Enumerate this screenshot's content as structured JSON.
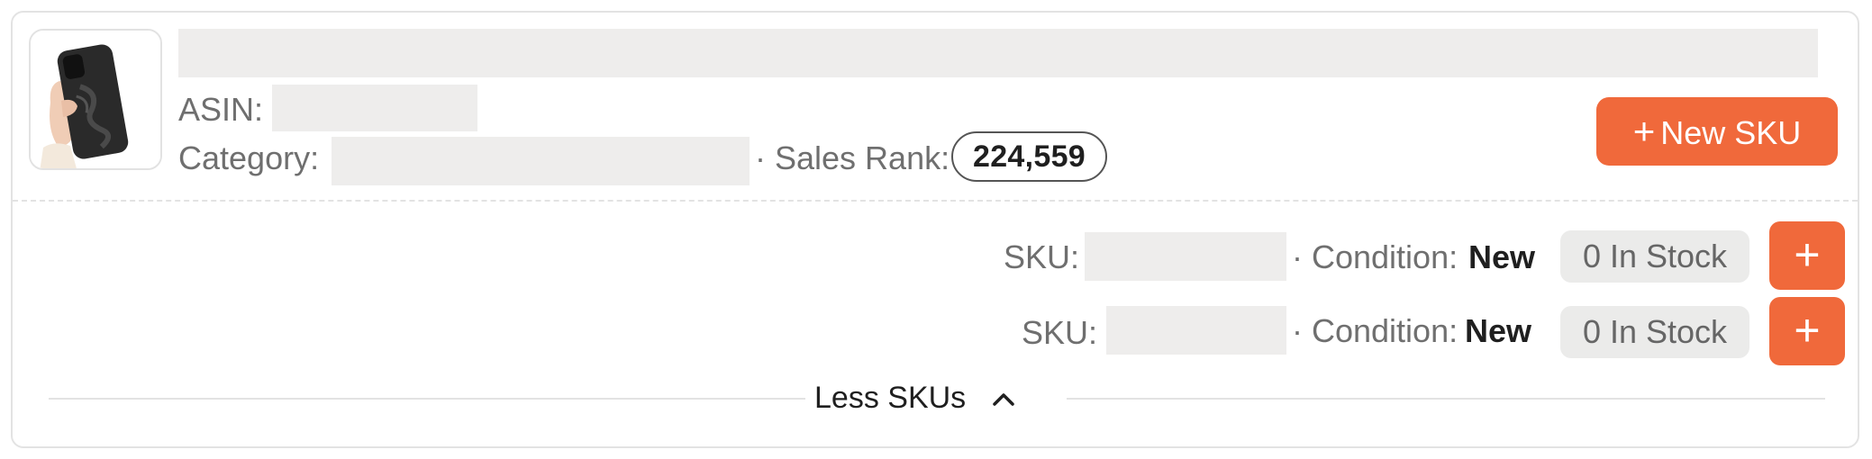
{
  "product": {
    "asin_label": "ASIN:",
    "category_label": "Category:",
    "sales_rank_label": "· Sales Rank:",
    "sales_rank_value": "224,559",
    "new_sku_label": "New SKU",
    "thumbnail_icon": "phone-case-thumbnail"
  },
  "skus": [
    {
      "sku_label": "SKU:",
      "condition_label": "· Condition:",
      "condition_value": "New",
      "stock_text": "0 In Stock",
      "add_icon": "plus-icon"
    },
    {
      "sku_label": "SKU:",
      "condition_label": "· Condition:",
      "condition_value": "New",
      "stock_text": "0 In Stock",
      "add_icon": "plus-icon"
    }
  ],
  "toggle": {
    "label": "Less SKUs",
    "icon": "chevron-up-icon"
  },
  "colors": {
    "accent": "#f0693b",
    "redaction": "#eeedec",
    "border": "#e3e3e3"
  }
}
